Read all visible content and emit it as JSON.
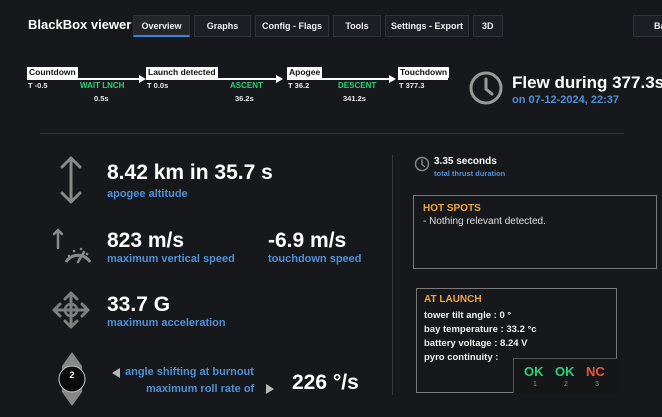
{
  "header": {
    "title": "BlackBox viewer",
    "tabs": [
      {
        "label": "Overview",
        "active": true
      },
      {
        "label": "Graphs"
      },
      {
        "label": "Config - Flags"
      },
      {
        "label": "Tools"
      },
      {
        "label": "Settings - Export"
      },
      {
        "label": "3D"
      }
    ],
    "back_label": "Back"
  },
  "timeline": {
    "events": [
      {
        "label": "Countdown",
        "time": "T -0.5"
      },
      {
        "label": "Launch detected",
        "time": "T 0.0s"
      },
      {
        "label": "Apogee",
        "time": "T 36.2"
      },
      {
        "label": "Touchdown",
        "time": "T 377.3"
      }
    ],
    "phases": [
      {
        "label": "WAIT LNCH",
        "duration": "0.5s"
      },
      {
        "label": "ASCENT",
        "duration": "36.2s"
      },
      {
        "label": "DESCENT",
        "duration": "341.2s"
      }
    ]
  },
  "flight": {
    "flew_label": "Flew during 377.3s",
    "date_label": "on 07-12-2024, 22:37"
  },
  "stats": {
    "apogee_value": "8.42 km in 35.7 s",
    "apogee_label": "apogee altitude",
    "vspeed_value": "823 m/s",
    "vspeed_label": "maximum vertical speed",
    "tdspeed_value": "-6.9 m/s",
    "tdspeed_label": "touchdown speed",
    "accel_value": "33.7 G",
    "accel_label": "maximum acceleration",
    "burnout_label": "angle shifting at burnout",
    "roll_label": "maximum roll rate of",
    "roll_value": "226 °/s",
    "gyro_badge": "2"
  },
  "thrust": {
    "value": "3.35 seconds",
    "label": "total thrust duration"
  },
  "hotspots": {
    "title": "HOT SPOTS",
    "text": "- Nothing relevant detected."
  },
  "at_launch": {
    "title": "AT LAUNCH",
    "lines": [
      "tower tilt angle : 0 °",
      "bay temperature : 33.2 °c",
      "battery voltage : 8.24 V",
      "pyro continuity :"
    ],
    "pyros": [
      {
        "status": "OK",
        "num": "1",
        "color": "#2ed07a"
      },
      {
        "status": "OK",
        "num": "2",
        "color": "#2ed07a"
      },
      {
        "status": "NC",
        "num": "3",
        "color": "#f0533a"
      }
    ]
  }
}
